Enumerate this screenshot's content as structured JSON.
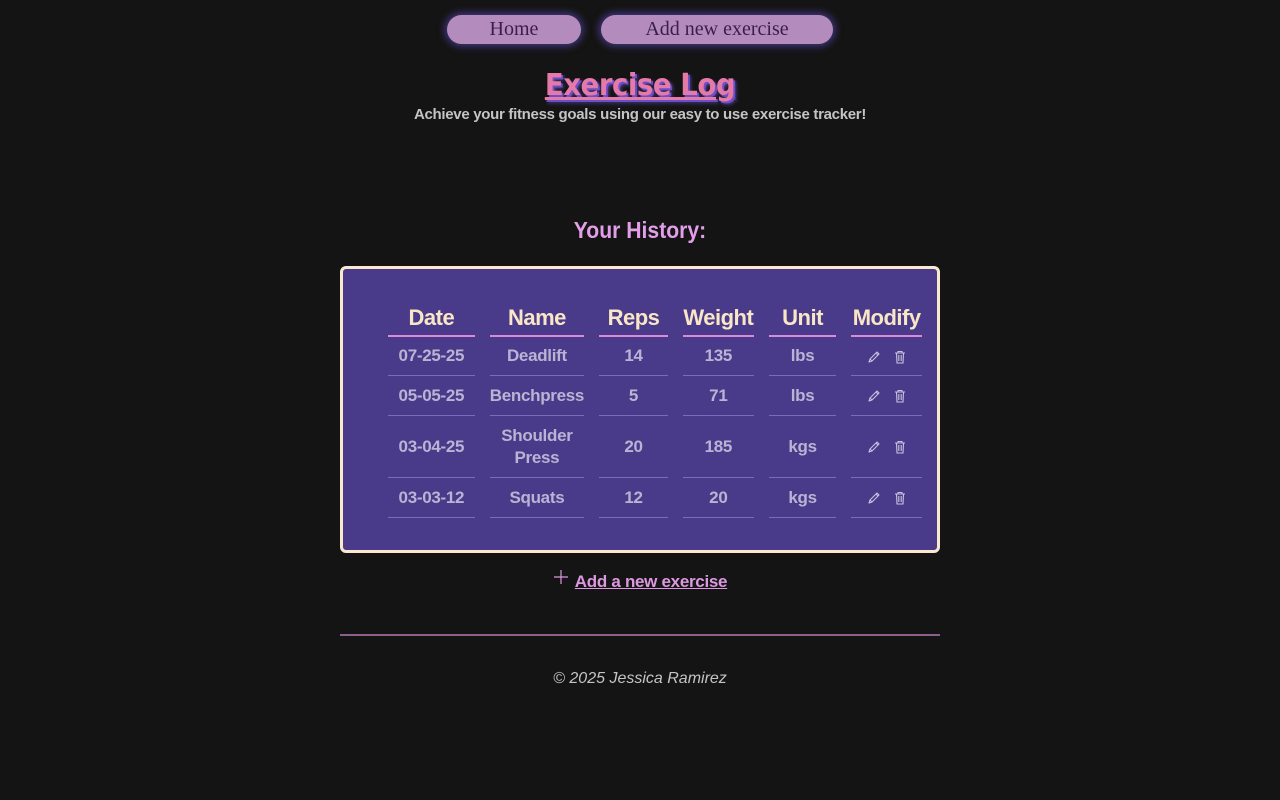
{
  "nav": {
    "home_label": "Home",
    "add_label": "Add new exercise"
  },
  "header": {
    "title": "Exercise Log",
    "subtitle": "Achieve your fitness goals using our easy to use exercise tracker!"
  },
  "history": {
    "heading": "Your History:",
    "columns": [
      "Date",
      "Name",
      "Reps",
      "Weight",
      "Unit",
      "Modify"
    ],
    "rows": [
      {
        "date": "07-25-25",
        "name": "Deadlift",
        "reps": "14",
        "weight": "135",
        "unit": "lbs"
      },
      {
        "date": "05-05-25",
        "name": "Benchpress",
        "reps": "5",
        "weight": "71",
        "unit": "lbs"
      },
      {
        "date": "03-04-25",
        "name": "Shoulder Press",
        "reps": "20",
        "weight": "185",
        "unit": "kgs"
      },
      {
        "date": "03-03-12",
        "name": "Squats",
        "reps": "12",
        "weight": "20",
        "unit": "kgs"
      }
    ],
    "edit_icon": "pencil-icon",
    "delete_icon": "trash-icon"
  },
  "add_link": {
    "label": "Add a new exercise",
    "icon": "plus-icon"
  },
  "footer": {
    "text": "© 2025 Jessica Ramirez"
  },
  "colors": {
    "background": "#141414",
    "panel": "#4a3b8a",
    "panel_border": "#fae9d0",
    "nav_button": "#b48bbd",
    "title": "#e57aa8",
    "accent": "#dc98e0"
  }
}
